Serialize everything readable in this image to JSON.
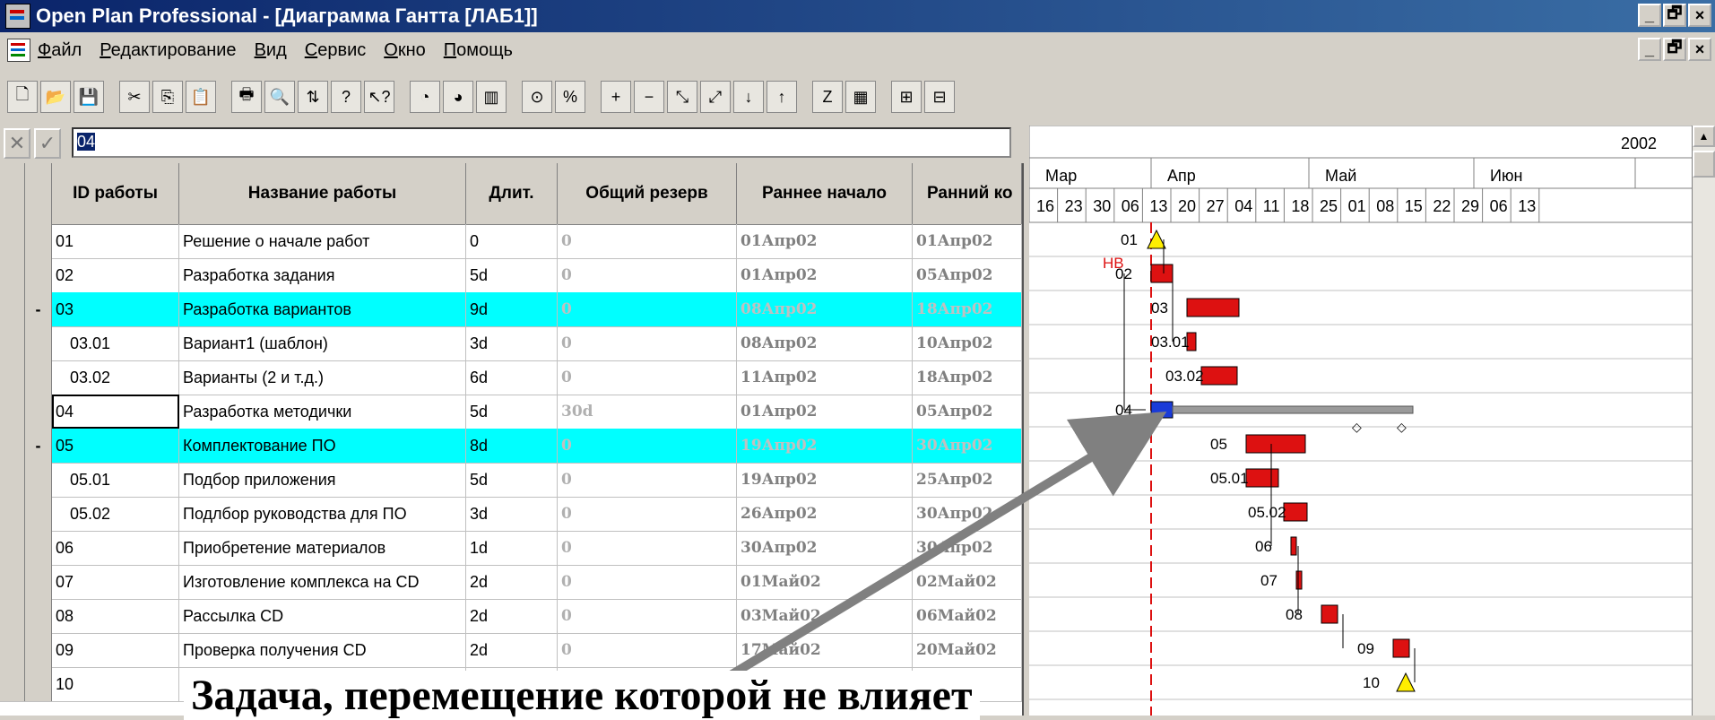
{
  "window": {
    "title": "Open Plan Professional - [Диаграмма Гантта [ЛАБ1]]",
    "buttons": [
      "_",
      "🗗",
      "×"
    ]
  },
  "menu": [
    "Файл",
    "Редактирование",
    "Вид",
    "Сервис",
    "Окно",
    "Помощь"
  ],
  "toolbar": [
    "new-icon",
    "open-icon",
    "save-icon",
    "cut-icon",
    "copy-icon",
    "paste-icon",
    "print-icon",
    "preview-icon",
    "export-icon",
    "help-icon",
    "context-help-icon",
    "clock-icon",
    "globe-icon",
    "chart-icon",
    "resource-icon",
    "percent-icon",
    "add-icon",
    "remove-icon",
    "link-icon",
    "unlink-icon",
    "down-icon",
    "up-icon",
    "z-sort-icon",
    "gantt-view-icon",
    "zoom-in-icon",
    "zoom-out-icon"
  ],
  "edit": {
    "value": "04"
  },
  "grid": {
    "headers": [
      "ID работы",
      "Название работы",
      "Длит.",
      "Общий резерв",
      "Раннее начало",
      "Ранний ко"
    ],
    "rows": [
      {
        "id": "01",
        "name": "Решение о начале работ",
        "dur": "0",
        "res": "0",
        "es": "01Апр02",
        "ef": "01Апр02",
        "hl": false,
        "expand": "",
        "indent": false
      },
      {
        "id": "02",
        "name": "Разработка задания",
        "dur": "5d",
        "res": "0",
        "es": "01Апр02",
        "ef": "05Апр02",
        "hl": false,
        "expand": "",
        "indent": false
      },
      {
        "id": "03",
        "name": "Разработка вариантов",
        "dur": "9d",
        "res": "0",
        "es": "08Апр02",
        "ef": "18Апр02",
        "hl": true,
        "expand": "-",
        "indent": false
      },
      {
        "id": "03.01",
        "name": "Вариант1 (шаблон)",
        "dur": "3d",
        "res": "0",
        "es": "08Апр02",
        "ef": "10Апр02",
        "hl": false,
        "expand": "",
        "indent": true
      },
      {
        "id": "03.02",
        "name": "Варианты (2 и т.д.)",
        "dur": "6d",
        "res": "0",
        "es": "11Апр02",
        "ef": "18Апр02",
        "hl": false,
        "expand": "",
        "indent": true
      },
      {
        "id": "04",
        "name": "Разработка методички",
        "dur": "5d",
        "res": "30d",
        "es": "01Апр02",
        "ef": "05Апр02",
        "hl": false,
        "expand": "",
        "indent": false,
        "selected": true
      },
      {
        "id": "05",
        "name": "Комплектование ПО",
        "dur": "8d",
        "res": "0",
        "es": "19Апр02",
        "ef": "30Апр02",
        "hl": true,
        "expand": "-",
        "indent": false
      },
      {
        "id": "05.01",
        "name": "Подбор приложения",
        "dur": "5d",
        "res": "0",
        "es": "19Апр02",
        "ef": "25Апр02",
        "hl": false,
        "expand": "",
        "indent": true
      },
      {
        "id": "05.02",
        "name": "Подлбор руководства для ПО",
        "dur": "3d",
        "res": "0",
        "es": "26Апр02",
        "ef": "30Апр02",
        "hl": false,
        "expand": "",
        "indent": true
      },
      {
        "id": "06",
        "name": "Приобретение материалов",
        "dur": "1d",
        "res": "0",
        "es": "30Апр02",
        "ef": "30Апр02",
        "hl": false,
        "expand": "",
        "indent": false
      },
      {
        "id": "07",
        "name": "Изготовление комплекса на CD",
        "dur": "2d",
        "res": "0",
        "es": "01Май02",
        "ef": "02Май02",
        "hl": false,
        "expand": "",
        "indent": false
      },
      {
        "id": "08",
        "name": "Рассылка CD",
        "dur": "2d",
        "res": "0",
        "es": "03Май02",
        "ef": "06Май02",
        "hl": false,
        "expand": "",
        "indent": false
      },
      {
        "id": "09",
        "name": "Проверка получения  CD",
        "dur": "2d",
        "res": "0",
        "es": "17Май02",
        "ef": "20Май02",
        "hl": false,
        "expand": "",
        "indent": false
      },
      {
        "id": "10",
        "name": "",
        "dur": "",
        "res": "",
        "es": "",
        "ef": "",
        "hl": false,
        "expand": "",
        "indent": false
      }
    ]
  },
  "gantt": {
    "year": "2002",
    "months": [
      "Мар",
      "Апр",
      "Май",
      "Июн"
    ],
    "days": [
      "16",
      "23",
      "30",
      "06",
      "13",
      "20",
      "27",
      "04",
      "11",
      "18",
      "25",
      "01",
      "08",
      "15",
      "22",
      "29",
      "06",
      "13"
    ],
    "labels": [
      "01",
      "НВ",
      "02",
      "03",
      "03.01",
      "03.02",
      "04",
      "05",
      "05.01",
      "05.02",
      "06",
      "07",
      "08",
      "09",
      "10"
    ]
  },
  "annotation": "Задача, перемещение которой не влияет",
  "colors": {
    "highlight": "#00ffff",
    "bar": "#dd1111",
    "titlebar": "#0a246a"
  }
}
